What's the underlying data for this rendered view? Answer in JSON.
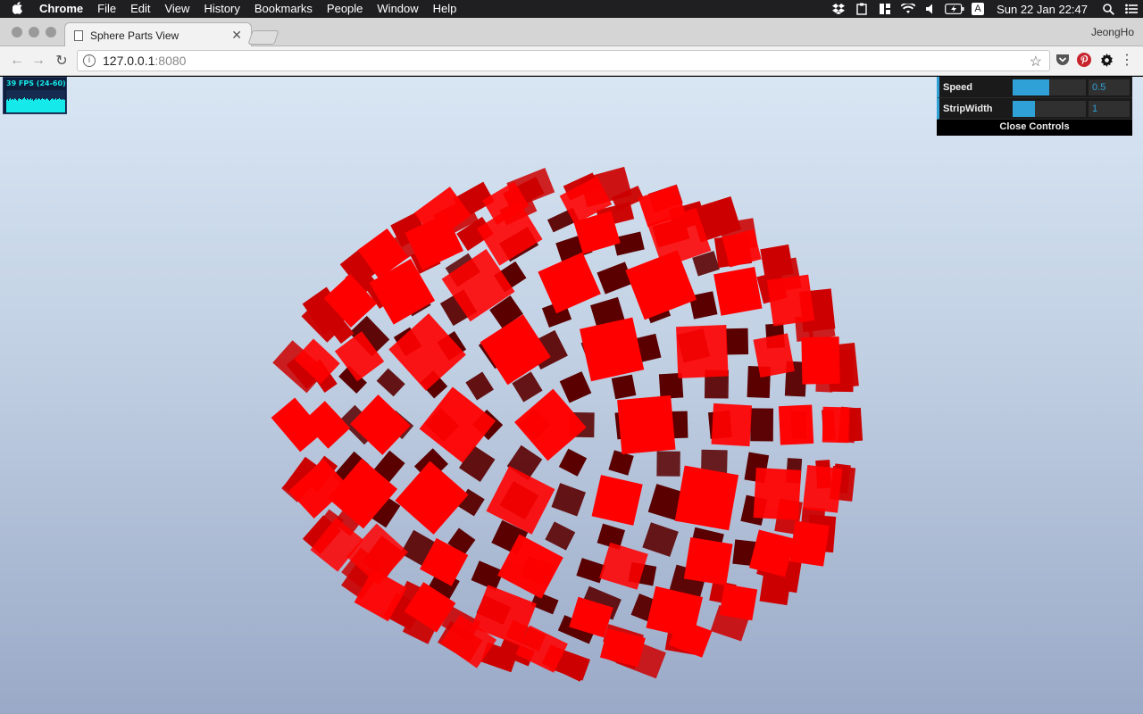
{
  "menubar": {
    "app": "Chrome",
    "items": [
      "File",
      "Edit",
      "View",
      "History",
      "Bookmarks",
      "People",
      "Window",
      "Help"
    ],
    "status_icons": [
      "dropbox-icon",
      "clipboard-icon",
      "app-icon",
      "wifi-icon",
      "volume-icon",
      "battery-icon",
      "input-source-icon"
    ],
    "input_source": "A",
    "clock": "Sun 22 Jan  22:47",
    "spotlight_icon": "search-icon",
    "notification_icon": "list-icon"
  },
  "browser": {
    "tab_title": "Sphere Parts View",
    "profile_name": "JeongHo",
    "url_host": "127.0.0.1",
    "url_port": ":8080"
  },
  "stats": {
    "fps_label": "39 FPS (24-60)",
    "bars": [
      14,
      15,
      13,
      15,
      16,
      14,
      15,
      15,
      14,
      16,
      15,
      14,
      13,
      15,
      16,
      15,
      15,
      14,
      15,
      16,
      17,
      15,
      14,
      16,
      15,
      14,
      15,
      16,
      14,
      15,
      13,
      14,
      15,
      16,
      14,
      15,
      16,
      15,
      14,
      15,
      16,
      15,
      15,
      14,
      15,
      16,
      15,
      14,
      13,
      14,
      15,
      16,
      15,
      14,
      15,
      16,
      14,
      15,
      15,
      16,
      15,
      14,
      15,
      14,
      15,
      14
    ]
  },
  "controls": {
    "speed_label": "Speed",
    "speed_value": "0.5",
    "speed_fraction": 0.5,
    "strip_label": "StripWidth",
    "strip_value": "1",
    "strip_fraction": 0.3,
    "close_label": "Close Controls"
  },
  "colors": {
    "accent": "#2fa1d6",
    "part_bright": "#ff0000",
    "part_mid": "#cc0000",
    "part_dark": "#5a0000"
  }
}
